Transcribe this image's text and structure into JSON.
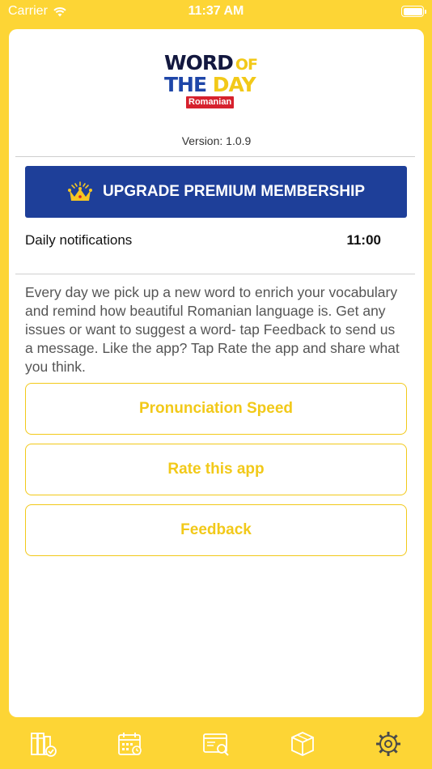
{
  "status_bar": {
    "carrier": "Carrier",
    "time": "11:37 AM"
  },
  "logo": {
    "word": "WORD",
    "of": "OF",
    "the": "THE",
    "day": "DAY",
    "language": "Romanian"
  },
  "version": "Version: 1.0.9",
  "premium": {
    "label": "UPGRADE PREMIUM MEMBERSHIP"
  },
  "notifications": {
    "label": "Daily notifications",
    "time": "11:00"
  },
  "description": "Every day we pick up a new word to enrich your vocabulary and remind how  beautiful Romanian language is. Get any issues or want to suggest a word- tap Feedback to send us a message. Like the app? Tap Rate the app and share what you think.",
  "buttons": {
    "pronunciation": "Pronunciation Speed",
    "rate": "Rate this app",
    "feedback": "Feedback"
  },
  "tabs": [
    {
      "icon": "books-icon"
    },
    {
      "icon": "calendar-icon"
    },
    {
      "icon": "browser-search-icon"
    },
    {
      "icon": "box-icon"
    },
    {
      "icon": "gear-icon"
    }
  ],
  "colors": {
    "background": "#FDD535",
    "accent": "#F2C919",
    "premium": "#1E3F99",
    "badge": "#D6212D"
  }
}
